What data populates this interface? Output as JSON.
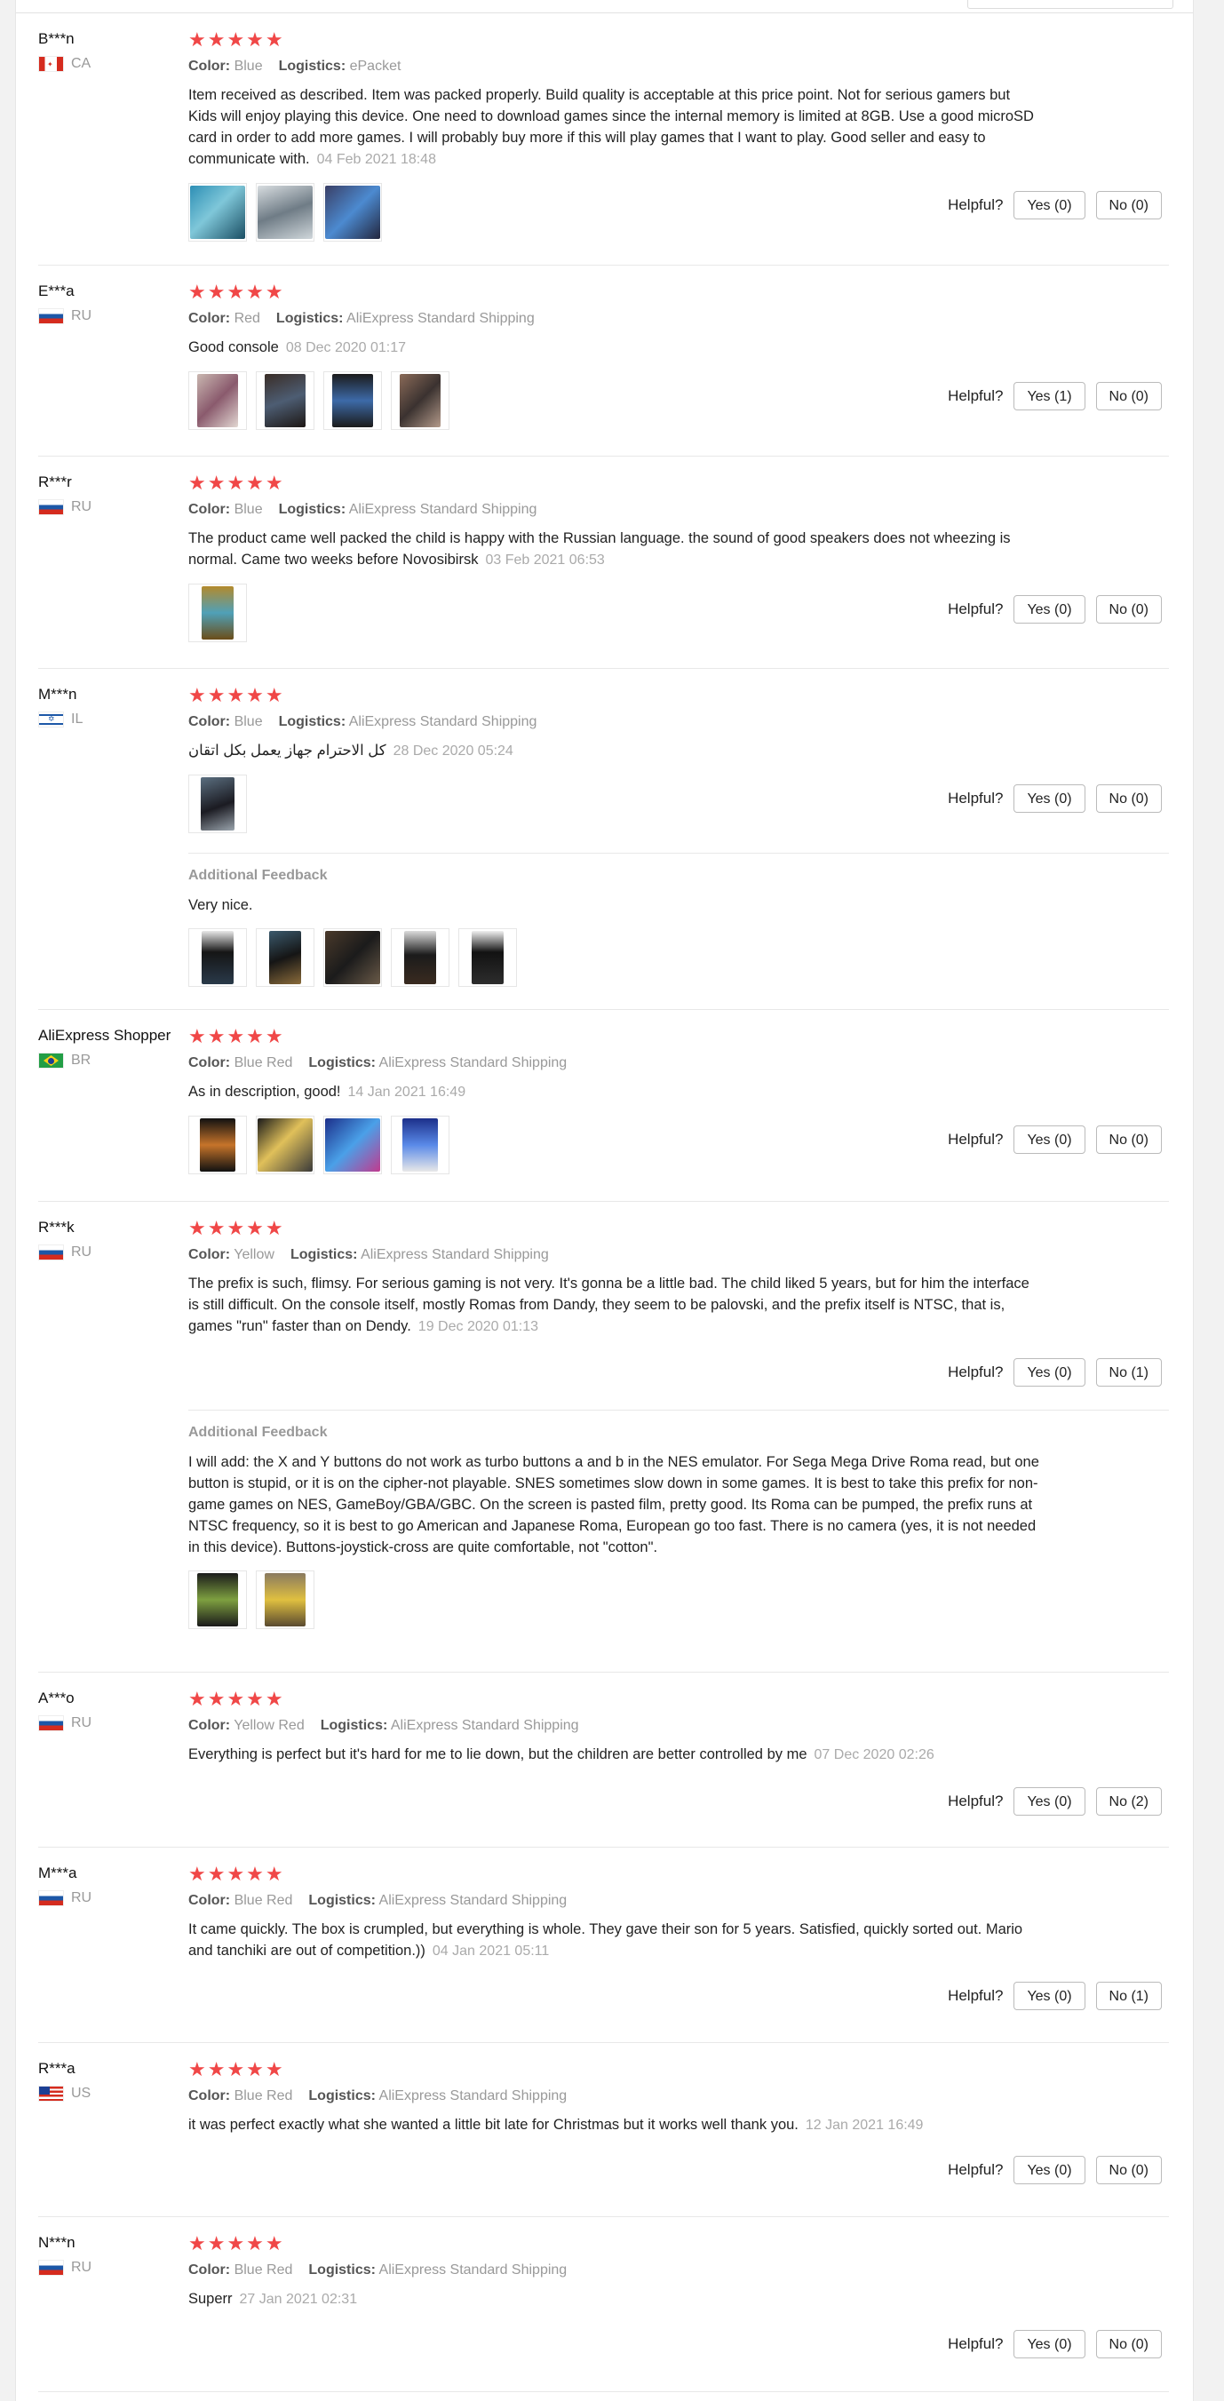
{
  "helpful_label": "Helpful?",
  "color_label": "Color:",
  "logistics_label": "Logistics:",
  "additional_title": "Additional Feedback",
  "stars": "★★★★★",
  "reviews": [
    {
      "name": "B***n",
      "country": "CA",
      "color": "Blue",
      "logistics": "ePacket",
      "text": "Item received as described. Item was packed properly. Build quality is acceptable at this price point. Not for serious gamers but Kids will enjoy playing this device. One need to download games since the internal memory is limited at 8GB. Use a good microSD card in order to add more games. I will probably buy more if this will play games that I want to play. Good seller and easy to communicate with.",
      "date": "04 Feb 2021 18:48",
      "yes": "Yes (0)",
      "no": "No (0)"
    },
    {
      "name": "E***a",
      "country": "RU",
      "color": "Red",
      "logistics": "AliExpress Standard Shipping",
      "text": "Good console",
      "date": "08 Dec 2020 01:17",
      "yes": "Yes (1)",
      "no": "No (0)"
    },
    {
      "name": "R***r",
      "country": "RU",
      "color": "Blue",
      "logistics": "AliExpress Standard Shipping",
      "text": "The product came well packed the child is happy with the Russian language. the sound of good speakers does not wheezing is normal. Came two weeks before Novosibirsk",
      "date": "03 Feb 2021 06:53",
      "yes": "Yes (0)",
      "no": "No (0)"
    },
    {
      "name": "M***n",
      "country": "IL",
      "color": "Blue",
      "logistics": "AliExpress Standard Shipping",
      "text": "كل الاحترام جهاز يعمل بكل اتقان",
      "date": "28 Dec 2020 05:24",
      "yes": "Yes (0)",
      "no": "No (0)",
      "additional": "Very nice."
    },
    {
      "name": "AliExpress Shopper",
      "country": "BR",
      "color": "Blue Red",
      "logistics": "AliExpress Standard Shipping",
      "text": "As in description, good!",
      "date": "14 Jan 2021 16:49",
      "yes": "Yes (0)",
      "no": "No (0)"
    },
    {
      "name": "R***k",
      "country": "RU",
      "color": "Yellow",
      "logistics": "AliExpress Standard Shipping",
      "text": "The prefix is such, flimsy. For serious gaming is not very. It's gonna be a little bad. The child liked 5 years, but for him the interface is still difficult. On the console itself, mostly Romas from Dandy, they seem to be palovski, and the prefix itself is NTSC, that is, games \"run\" faster than on Dendy.",
      "date": "19 Dec 2020 01:13",
      "yes": "Yes (0)",
      "no": "No (1)",
      "additional": "I will add: the X and Y buttons do not work as turbo buttons a and b in the NES emulator. For Sega Mega Drive Roma read, but one button is stupid, or it is on the cipher-not playable. SNES sometimes slow down in some games. It is best to take this prefix for non-game games on NES, GameBoy/GBA/GBC. On the screen is pasted film, pretty good. Its Roma can be pumped, the prefix runs at NTSC frequency, so it is best to go American and Japanese Roma, European go too fast. There is no camera (yes, it is not needed in this device). Buttons-joystick-cross are quite comfortable, not \"cotton\"."
    },
    {
      "name": "A***o",
      "country": "RU",
      "color": "Yellow Red",
      "logistics": "AliExpress Standard Shipping",
      "text": "Everything is perfect but it's hard for me to lie down, but the children are better controlled by me",
      "date": "07 Dec 2020 02:26",
      "yes": "Yes (0)",
      "no": "No (2)"
    },
    {
      "name": "M***a",
      "country": "RU",
      "color": "Blue Red",
      "logistics": "AliExpress Standard Shipping",
      "text": "It came quickly. The box is crumpled, but everything is whole. They gave their son for 5 years. Satisfied, quickly sorted out. Mario and tanchiki are out of competition.))",
      "date": "04 Jan 2021 05:11",
      "yes": "Yes (0)",
      "no": "No (1)"
    },
    {
      "name": "R***a",
      "country": "US",
      "color": "Blue Red",
      "logistics": "AliExpress Standard Shipping",
      "text": "it was perfect exactly what she wanted a little bit late for Christmas but it works well thank you.",
      "date": "12 Jan 2021 16:49",
      "yes": "Yes (0)",
      "no": "No (0)"
    },
    {
      "name": "N***n",
      "country": "RU",
      "color": "Blue Red",
      "logistics": "AliExpress Standard Shipping",
      "text": "Superr",
      "date": "27 Jan 2021 02:31",
      "yes": "Yes (0)",
      "no": "No (0)"
    }
  ]
}
